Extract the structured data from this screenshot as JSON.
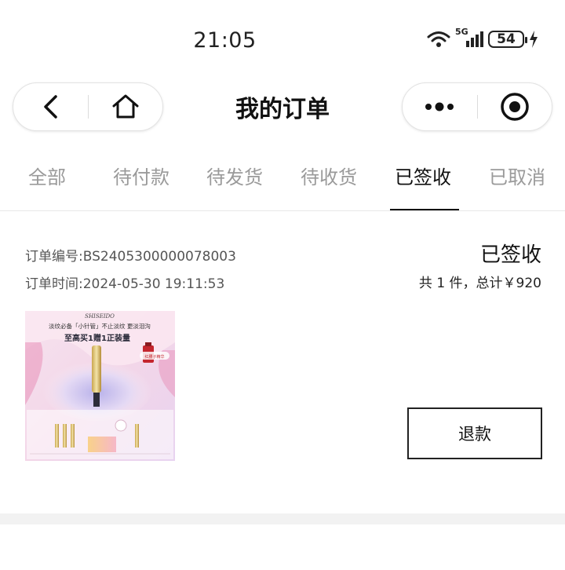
{
  "status_bar": {
    "time": "21:05",
    "network_label": "5G",
    "battery_level": "54",
    "icons": [
      "wifi-icon",
      "signal-icon",
      "battery-icon",
      "charging-icon"
    ]
  },
  "nav": {
    "title": "我的订单",
    "icons": [
      "back-arrow-icon",
      "home-icon",
      "more-dots-icon",
      "close-target-icon"
    ]
  },
  "tabs": [
    {
      "label": "全部",
      "active": false
    },
    {
      "label": "待付款",
      "active": false
    },
    {
      "label": "待发货",
      "active": false
    },
    {
      "label": "待收货",
      "active": false
    },
    {
      "label": "已签收",
      "active": true
    },
    {
      "label": "已取消",
      "active": false
    }
  ],
  "order": {
    "number_line": "订单编号:BS2405300000078003",
    "time_line": "订单时间:2024-05-30 19:11:53",
    "status": "已签收",
    "summary": "共 1 件，总计￥920",
    "refund_label": "退款",
    "product_image": {
      "brand": "SHISEIDO",
      "headline": "淡纹必备「小针管」不止淡纹 更淡泪沟",
      "promo": "至高买1赠1正装量",
      "gift_tag": "红腰子精华"
    }
  },
  "colors": {
    "active_tab": "#111111",
    "inactive_tab": "#9a9a9a",
    "section_gap": "#f2f2f2"
  }
}
